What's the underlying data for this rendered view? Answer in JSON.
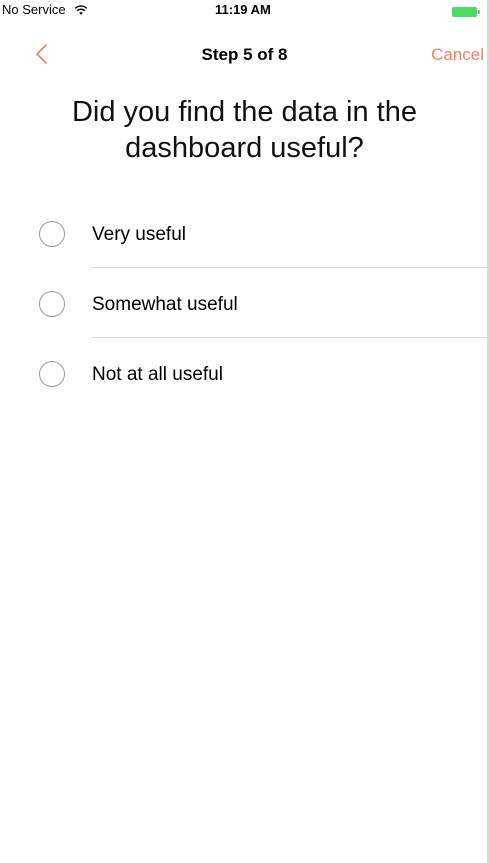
{
  "status_bar": {
    "carrier": "No Service",
    "time": "11:19 AM",
    "wifi_icon": "wifi-icon",
    "battery_icon": "battery-icon",
    "battery_color": "#4cd964"
  },
  "nav": {
    "back_icon": "chevron-left-icon",
    "title": "Step 5 of 8",
    "cancel_label": "Cancel",
    "accent_color": "#f47e5f"
  },
  "question": {
    "text": "Did you find the data in the dashboard useful?"
  },
  "options": [
    {
      "label": "Very useful",
      "selected": false
    },
    {
      "label": "Somewhat useful",
      "selected": false
    },
    {
      "label": "Not at all useful",
      "selected": false
    }
  ]
}
